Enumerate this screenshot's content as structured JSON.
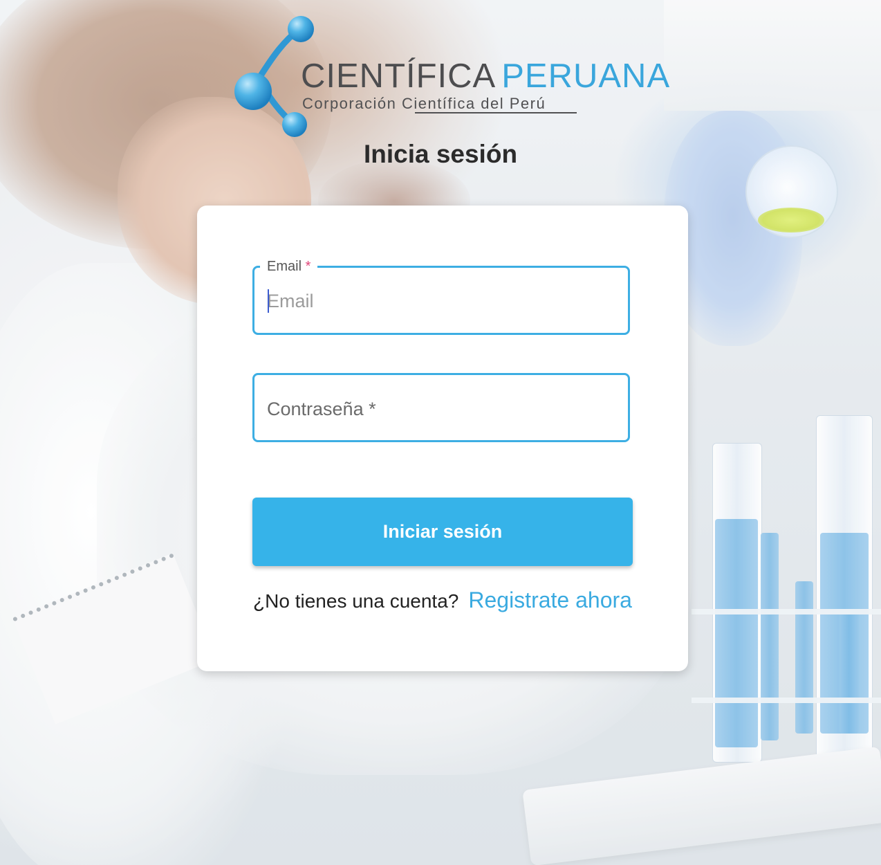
{
  "brand": {
    "name_part1": "CIENTÍFICA",
    "name_part2": "PERUANA",
    "tagline": "Corporación Científica del Perú",
    "logo_icon": "molecule-icon",
    "colors": {
      "blue": "#3aa6dc",
      "gray": "#4d4d4f"
    }
  },
  "page": {
    "title": "Inicia sesión"
  },
  "form": {
    "email": {
      "label": "Email",
      "required_mark": "*",
      "placeholder": "Email",
      "value": ""
    },
    "password": {
      "label": "Contraseña *",
      "value": ""
    },
    "submit_label": "Iniciar sesión",
    "accent_color": "#36b3e9"
  },
  "register": {
    "prompt": "¿No tienes una cuenta?",
    "link_label": "Registrate ahora"
  }
}
